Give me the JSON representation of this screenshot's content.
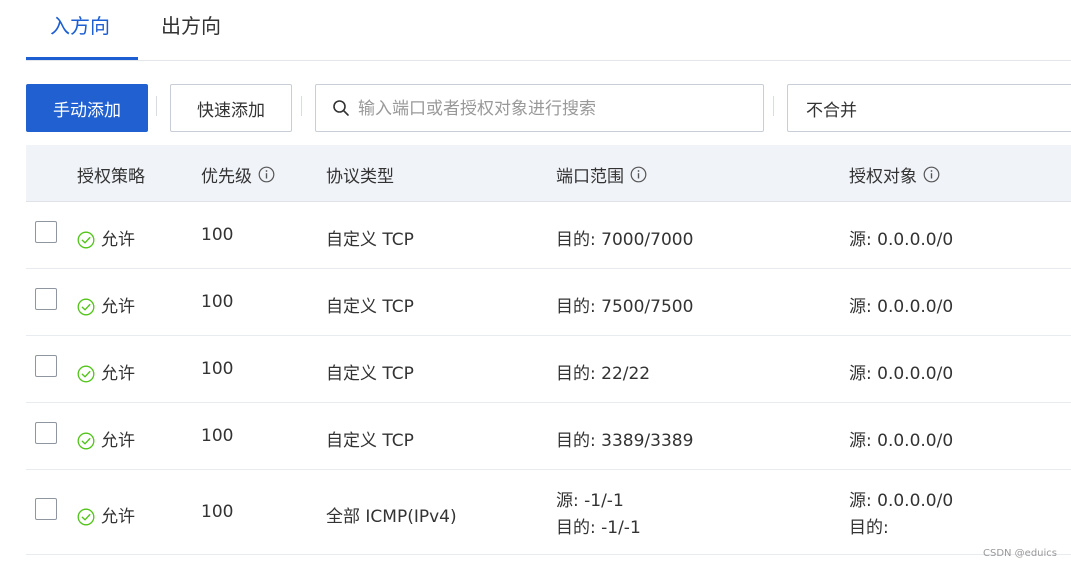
{
  "tabs": [
    {
      "label": "入方向",
      "active": true
    },
    {
      "label": "出方向",
      "active": false
    }
  ],
  "toolbar": {
    "manual_add_label": "手动添加",
    "quick_add_label": "快速添加",
    "search_placeholder": "输入端口或者授权对象进行搜索",
    "merge_select_value": "不合并"
  },
  "table": {
    "columns": {
      "policy": "授权策略",
      "priority": "优先级",
      "protocol": "协议类型",
      "port_range": "端口范围",
      "target": "授权对象"
    },
    "rows": [
      {
        "policy": "允许",
        "priority": "100",
        "protocol": "自定义 TCP",
        "port_range": [
          "目的: 7000/7000"
        ],
        "target": [
          "源: 0.0.0.0/0"
        ]
      },
      {
        "policy": "允许",
        "priority": "100",
        "protocol": "自定义 TCP",
        "port_range": [
          "目的: 7500/7500"
        ],
        "target": [
          "源: 0.0.0.0/0"
        ]
      },
      {
        "policy": "允许",
        "priority": "100",
        "protocol": "自定义 TCP",
        "port_range": [
          "目的: 22/22"
        ],
        "target": [
          "源: 0.0.0.0/0"
        ]
      },
      {
        "policy": "允许",
        "priority": "100",
        "protocol": "自定义 TCP",
        "port_range": [
          "目的: 3389/3389"
        ],
        "target": [
          "源: 0.0.0.0/0"
        ]
      },
      {
        "policy": "允许",
        "priority": "100",
        "protocol": "全部 ICMP(IPv4)",
        "port_range": [
          "源: -1/-1",
          "目的: -1/-1"
        ],
        "target": [
          "源: 0.0.0.0/0",
          "目的:"
        ]
      }
    ]
  },
  "watermark": "CSDN @eduics",
  "colors": {
    "accent": "#1d5fd3",
    "primary_button": "#2060d0",
    "allow_green": "#52c41a",
    "header_bg": "#f0f3f8"
  }
}
